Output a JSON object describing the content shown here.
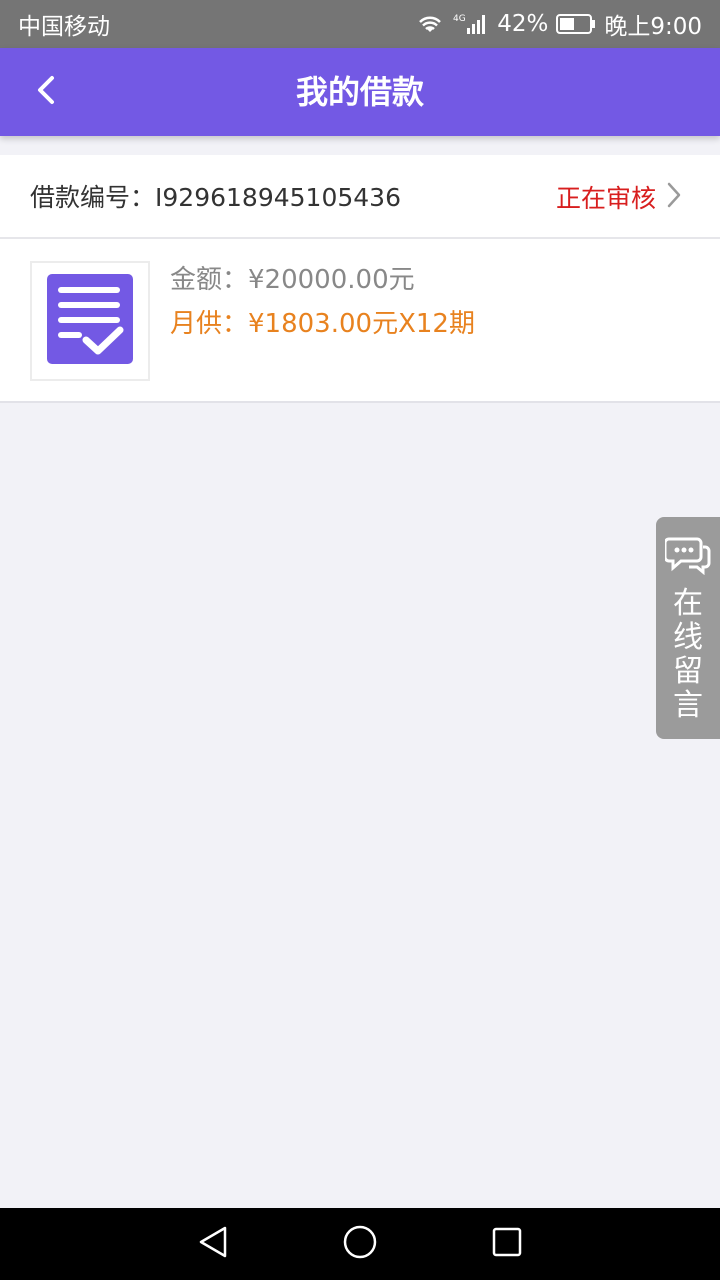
{
  "statusbar": {
    "carrier": "中国移动",
    "network": "4G",
    "battery": "42%",
    "time": "晚上9:00"
  },
  "header": {
    "title": "我的借款",
    "back_icon": "chevron-left-icon"
  },
  "loan": {
    "number_label": "借款编号：",
    "number": "I929618945105436",
    "status": "正在审核",
    "amount_label": "金额：",
    "amount": "¥20000.00元",
    "monthly_label": "月供：",
    "monthly": "¥1803.00元X12期",
    "thumbnail_icon": "document-check-icon"
  },
  "float_button": {
    "icon": "chat-bubble-icon",
    "label": "在线留言"
  },
  "colors": {
    "primary": "#7359e4",
    "status_red": "#d81e1e",
    "monthly_orange": "#e8821f",
    "background": "#f2f2f7"
  },
  "system_nav": {
    "back_icon": "triangle-back-icon",
    "home_icon": "circle-home-icon",
    "recents_icon": "square-recents-icon"
  }
}
